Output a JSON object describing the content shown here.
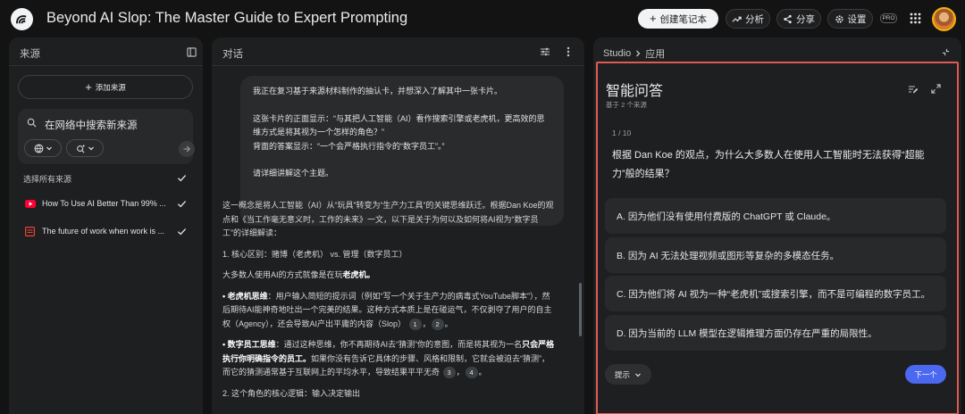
{
  "app": {
    "title": "Beyond AI Slop: The Master Guide to Expert Prompting"
  },
  "topbar": {
    "create_notebook": "创建笔记本",
    "analytics": "分析",
    "share": "分享",
    "settings": "设置",
    "pro_badge": "PRO"
  },
  "sources_panel": {
    "title": "来源",
    "add_source": "添加来源",
    "search_placeholder": "在网络中搜索新来源",
    "select_all": "选择所有来源",
    "items": [
      {
        "label": "How To Use AI Better Than 99% ...",
        "icon": "youtube-icon",
        "checked": true
      },
      {
        "label": "The future of work when work is ...",
        "icon": "document-icon",
        "checked": true
      }
    ]
  },
  "chat_panel": {
    "title": "对话",
    "user_message": [
      "我正在复习基于来源材料制作的抽认卡，并想深入了解其中一张卡片。",
      "这张卡片的正面显示：“与其把人工智能（AI）看作搜索引擎或老虎机，更高效的思维方式是将其视为一个怎样的角色？”",
      "背面的答案显示：“一个会严格执行指令的“数字员工”。”",
      "请详细讲解这个主题。"
    ],
    "reply": {
      "intro": "这一概念是将人工智能（AI）从“玩具”转变为“生产力工具”的关键思维跃迁。根据Dan Koe的观点和《当工作毫无意义时，工作的未来》一文，以下是关于为何以及如何将AI视为“数字员工”的详细解读：",
      "section1": "1. 核心区别：赌博（老虎机） vs. 管理（数字员工）",
      "para_lead": "大多数人使用AI的方式就像是在玩",
      "para_bold": "老虎机。",
      "bullet1_bold": "• 老虎机思维",
      "bullet1_text": "：用户输入简短的提示词（例如“写一个关于生产力的病毒式YouTube脚本”），然后期待AI能神奇地吐出一个完美的结果。这种方式本质上是在碰运气，不仅剥夺了用户的自主权（Agency），还会导致AI产出平庸的内容（Slop）",
      "bullet1_cites": [
        "1",
        "2"
      ],
      "bullet2_bold": "• 数字员工思维",
      "bullet2_text_a": "：通过这种思维，你不再期待AI去“猜测”你的意图，而是将其视为一名",
      "bullet2_bold2": "只会严格执行你明确指令的员工。",
      "bullet2_text_b": "如果你没有告诉它具体的步骤、风格和限制，它就会被迫去“猜测”，而它的猜测通常基于互联网上的平均水平，导致结果平平无奇",
      "bullet2_cites": [
        "3",
        "4"
      ],
      "section2": "2. 这个角色的核心逻辑：输入决定输出"
    }
  },
  "studio_panel": {
    "breadcrumb_root": "Studio",
    "breadcrumb_current": "应用",
    "quiz_title": "智能问答",
    "quiz_subtitle": "基于 2 个来源",
    "counter": "1 / 10",
    "question": "根据 Dan Koe 的观点，为什么大多数人在使用人工智能时无法获得“超能力”般的结果？",
    "options": [
      "A.  因为他们没有使用付费版的 ChatGPT 或 Claude。",
      "B.  因为 AI 无法处理视频或图形等复杂的多模态任务。",
      "C.  因为他们将 AI 视为一种“老虎机”或搜索引擎，而不是可编程的数字员工。",
      "D.  因为当前的 LLM 模型在逻辑推理方面仍存在严重的局限性。"
    ],
    "hint": "提示",
    "next": "下一个"
  },
  "colors": {
    "accent": "#4a68f0",
    "highlight_border": "#e05a54",
    "background": "#131314",
    "panel": "#1e1f20"
  }
}
